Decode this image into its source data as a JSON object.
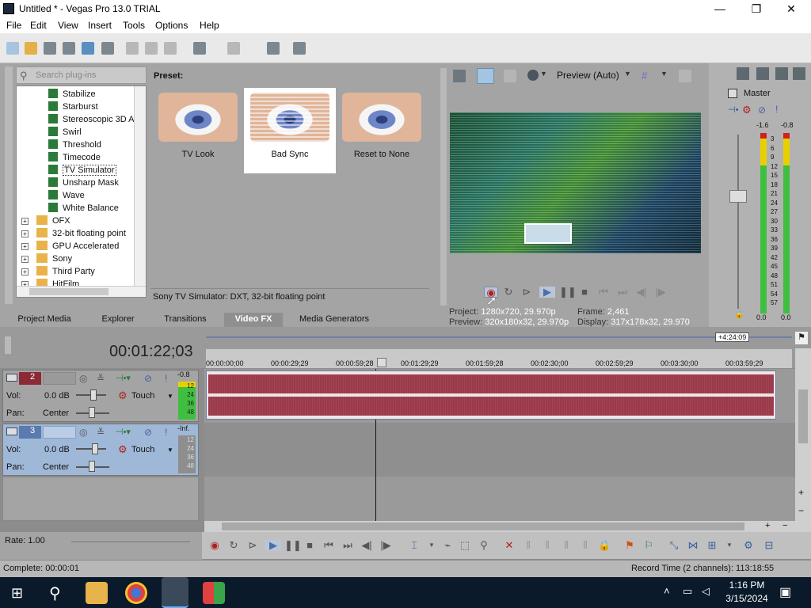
{
  "window": {
    "title": "Untitled * - Vegas Pro 13.0 TRIAL",
    "minimize": "—",
    "maximize": "❐",
    "close": "✕"
  },
  "menu": [
    "File",
    "Edit",
    "View",
    "Insert",
    "Tools",
    "Options",
    "Help"
  ],
  "plugins": {
    "search_placeholder": "Search plug-ins",
    "preset_label": "Preset:",
    "fx_items": [
      "Stabilize",
      "Starburst",
      "Stereoscopic 3D A",
      "Swirl",
      "Threshold",
      "Timecode",
      "TV Simulator",
      "Unsharp Mask",
      "Wave",
      "White Balance"
    ],
    "selected_fx": "TV Simulator",
    "folders": [
      "OFX",
      "32-bit floating point",
      "GPU Accelerated",
      "Sony",
      "Third Party",
      "HitFilm"
    ],
    "presets": [
      "TV Look",
      "Bad Sync",
      "Reset to None"
    ],
    "selected_preset": "Bad Sync",
    "description": "Sony TV Simulator: DXT, 32-bit floating point",
    "tabs": [
      "Project Media",
      "Explorer",
      "Transitions",
      "Video FX",
      "Media Generators"
    ],
    "active_tab": "Video FX"
  },
  "preview": {
    "mode": "Preview (Auto)",
    "project_label": "Project:",
    "project_value": "1280x720, 29.970p",
    "preview_label": "Preview:",
    "preview_value": "320x180x32, 29.970p",
    "frame_label": "Frame:",
    "frame_value": "2,461",
    "display_label": "Display:",
    "display_value": "317x178x32, 29.970"
  },
  "master": {
    "label": "Master",
    "peak_left": "-1.6",
    "peak_right": "-0.8",
    "scale": [
      "3",
      "6",
      "9",
      "12",
      "15",
      "18",
      "21",
      "24",
      "27",
      "30",
      "33",
      "36",
      "39",
      "42",
      "45",
      "48",
      "51",
      "54",
      "57"
    ],
    "bottom_left": "0.0",
    "bottom_right": "0.0"
  },
  "timeline": {
    "timecode": "00:01:22;03",
    "overview_label": "+4:24:09",
    "ruler": [
      "00:00:00;00",
      "00:00:29;29",
      "00:00:59;28",
      "00:01:29;29",
      "00:01:59;28",
      "00:02:30;00",
      "00:02:59;29",
      "00:03:30;00",
      "00:03:59;29"
    ],
    "tracks": [
      {
        "number": "2",
        "vol_label": "Vol:",
        "vol": "0.0 dB",
        "pan_label": "Pan:",
        "pan": "Center",
        "mode": "Touch",
        "meter_top": "-0.8",
        "meter_scale": [
          "12",
          "24",
          "36",
          "48"
        ]
      },
      {
        "number": "3",
        "vol_label": "Vol:",
        "vol": "0.0 dB",
        "pan_label": "Pan:",
        "pan": "Center",
        "mode": "Touch",
        "meter_top": "-Inf.",
        "meter_scale": [
          "12",
          "24",
          "36",
          "48"
        ]
      }
    ]
  },
  "transport": {
    "rate": "Rate: 1.00"
  },
  "status": {
    "left": "Complete: 00:00:01",
    "right": "Record Time (2 channels): 113:18:55"
  },
  "taskbar": {
    "time": "1:16 PM",
    "date": "3/15/2024"
  },
  "colors": {
    "waveform": "#9a3a4a",
    "meter_green": "#3fbf3f",
    "meter_yellow": "#e8d000",
    "selected_track": "#9fb8d7"
  }
}
